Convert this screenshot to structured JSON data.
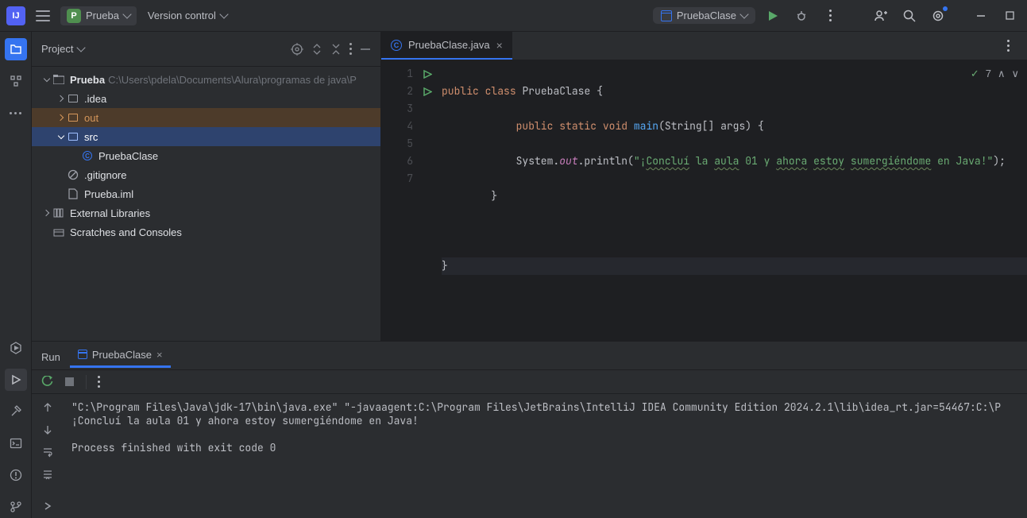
{
  "topbar": {
    "project_initial": "P",
    "project_name": "Prueba",
    "vcs_label": "Version control",
    "run_config": "PruebaClase"
  },
  "project_panel": {
    "title": "Project",
    "root": {
      "name": "Prueba",
      "path": "C:\\Users\\pdela\\Documents\\Alura\\programas de java\\P"
    },
    "items": {
      "idea": ".idea",
      "out": "out",
      "src": "src",
      "prueba_clase": "PruebaClase",
      "gitignore": ".gitignore",
      "iml": "Prueba.iml",
      "ext_lib": "External Libraries",
      "scratches": "Scratches and Consoles"
    }
  },
  "editor": {
    "tab_label": "PruebaClase.java",
    "inspections": "7",
    "code": {
      "l1_a": "public",
      "l1_b": "class",
      "l1_c": "PruebaClase",
      "l1_d": "{",
      "l2_a": "public",
      "l2_b": "static",
      "l2_c": "void",
      "l2_d": "main",
      "l2_e": "(String[] args) {",
      "l3_a": "System.",
      "l3_b": "out",
      "l3_c": ".println(",
      "l3_s1": "\"¡",
      "l3_w1": "Concluí",
      "l3_s2": " la ",
      "l3_w2": "aula",
      "l3_s3": " 01 y ",
      "l3_w3": "ahora",
      "l3_s4": " ",
      "l3_w4": "estoy",
      "l3_s5": " ",
      "l3_w5": "sumergiéndome",
      "l3_s6": " en Java!\"",
      "l3_d": ");",
      "l4": "}",
      "l6": "}"
    },
    "line_numbers": [
      "1",
      "2",
      "3",
      "4",
      "5",
      "6",
      "7"
    ]
  },
  "run": {
    "title": "Run",
    "tab": "PruebaClase",
    "console": {
      "cmd": "\"C:\\Program Files\\Java\\jdk-17\\bin\\java.exe\" \"-javaagent:C:\\Program Files\\JetBrains\\IntelliJ IDEA Community Edition 2024.2.1\\lib\\idea_rt.jar=54467:C:\\P",
      "output": "¡Concluí la aula 01 y ahora estoy sumergiéndome en Java!",
      "exit": "Process finished with exit code 0"
    }
  }
}
